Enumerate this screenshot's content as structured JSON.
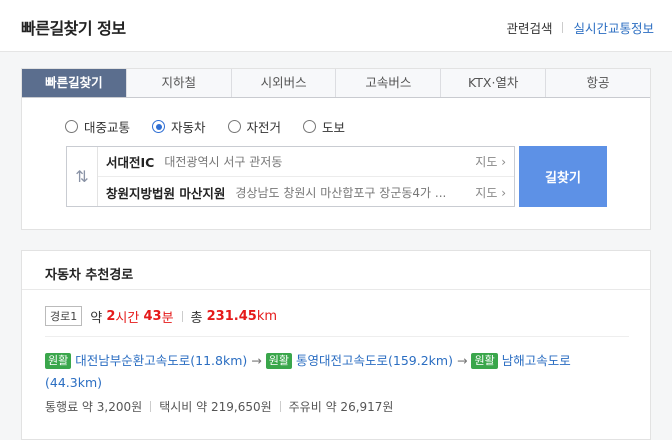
{
  "header": {
    "title": "빠른길찾기 정보",
    "link1": "관련검색",
    "link2": "실시간교통정보"
  },
  "tabs": [
    "빠른길찾기",
    "지하철",
    "시외버스",
    "고속버스",
    "KTX·열차",
    "항공"
  ],
  "modes": [
    "대중교통",
    "자동차",
    "자전거",
    "도보"
  ],
  "route": {
    "origin_name": "서대전IC",
    "origin_addr": "대전광역시 서구 관저동",
    "dest_name": "창원지방법원 마산지원",
    "dest_addr": "경상남도 창원시 마산합포구 장군동4가 ...",
    "map_label": "지도 ›",
    "swap_icon": "⇅"
  },
  "search_button": "길찾기",
  "result": {
    "title": "자동차 추천경로",
    "badge": "경로1",
    "time_prefix": "약",
    "hours": "2",
    "hours_unit": "시간",
    "minutes": "43",
    "minutes_unit": "분",
    "dist_prefix": "총",
    "distance": "231.45",
    "distance_unit": "km",
    "road_tag": "원활",
    "roads": [
      "대전남부순환고속도로(11.8km)",
      "통영대전고속도로(159.2km)",
      "남해고속도로"
    ],
    "road_last_tail": "(44.3km)",
    "arrow": "→",
    "toll": "통행료 약 3,200원",
    "taxi": "택시비 약 219,650원",
    "fuel": "주유비 약 26,917원"
  },
  "colors": {
    "active_tab": "#5b6e8e",
    "search_button": "#5d91e6",
    "tag": "#3aa64b",
    "link": "#2b6ec2",
    "highlight": "#e51a1a"
  }
}
